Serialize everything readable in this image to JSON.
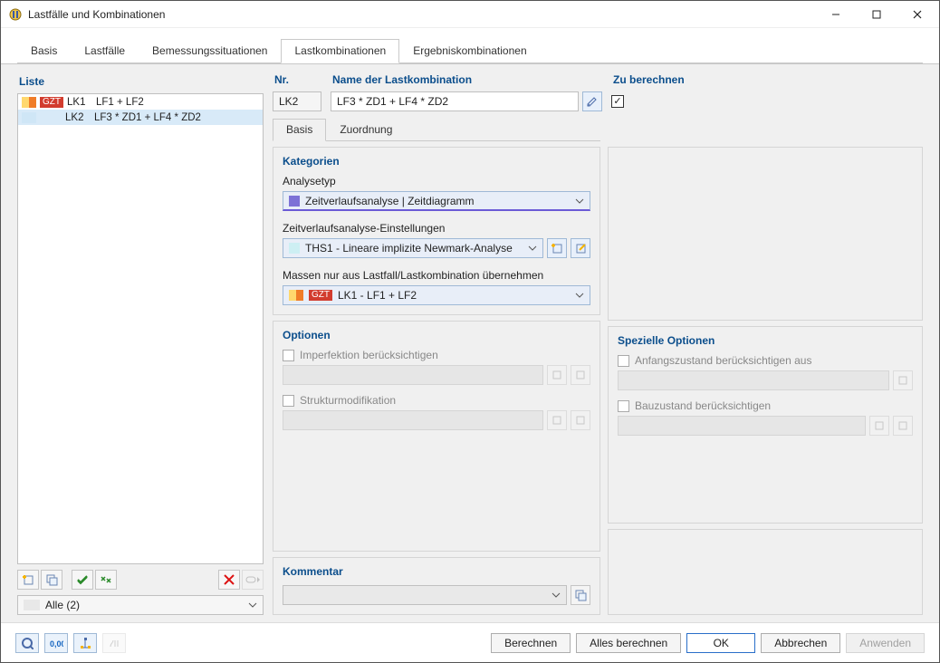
{
  "window": {
    "title": "Lastfälle und Kombinationen"
  },
  "tabs_main": [
    "Basis",
    "Lastfälle",
    "Bemessungssituationen",
    "Lastkombinationen",
    "Ergebniskombinationen"
  ],
  "tabs_main_active": 3,
  "left": {
    "title": "Liste",
    "rows": [
      {
        "badge_text": "GZT",
        "badge_bg": "#d23c2e",
        "sw1": "#ffd86e",
        "sw2": "#f07c28",
        "code": "LK1",
        "desc": "LF1 + LF2",
        "selected": false
      },
      {
        "badge_text": "",
        "badge_bg": "#cfe6f6",
        "sw1": "#cfe6f6",
        "sw2": "#cfe6f6",
        "code": "LK2",
        "desc": "LF3 * ZD1 + LF4 * ZD2",
        "selected": true
      }
    ],
    "filter_text": "Alle (2)"
  },
  "header": {
    "nr_label": "Nr.",
    "nr_value": "LK2",
    "name_label": "Name der Lastkombination",
    "name_value": "LF3 * ZD1 + LF4 * ZD2",
    "calc_label": "Zu berechnen",
    "calc_checked": true
  },
  "subtabs": [
    "Basis",
    "Zuordnung"
  ],
  "subtabs_active": 0,
  "categories": {
    "title": "Kategorien",
    "analysis_label": "Analysetyp",
    "analysis_value": "Zeitverlaufsanalyse | Zeitdiagramm",
    "analysis_color": "#7d72d6",
    "tha_label": "Zeitverlaufsanalyse-Einstellungen",
    "tha_value": "THS1 - Lineare implizite Newmark-Analyse",
    "tha_color": "#cdeff3",
    "mass_label": "Massen nur aus Lastfall/Lastkombination übernehmen",
    "mass_badge": "GZT",
    "mass_value": "LK1 - LF1 + LF2",
    "mass_sw1": "#ffd86e",
    "mass_sw2": "#f07c28",
    "mass_badge_bg": "#d23c2e"
  },
  "options": {
    "title": "Optionen",
    "imperfection": "Imperfektion berücksichtigen",
    "struct": "Strukturmodifikation"
  },
  "special": {
    "title": "Spezielle Optionen",
    "initial": "Anfangszustand berücksichtigen aus",
    "constr": "Bauzustand berücksichtigen"
  },
  "comment": {
    "title": "Kommentar"
  },
  "footer": {
    "calc": "Berechnen",
    "calc_all": "Alles berechnen",
    "ok": "OK",
    "cancel": "Abbrechen",
    "apply": "Anwenden"
  }
}
